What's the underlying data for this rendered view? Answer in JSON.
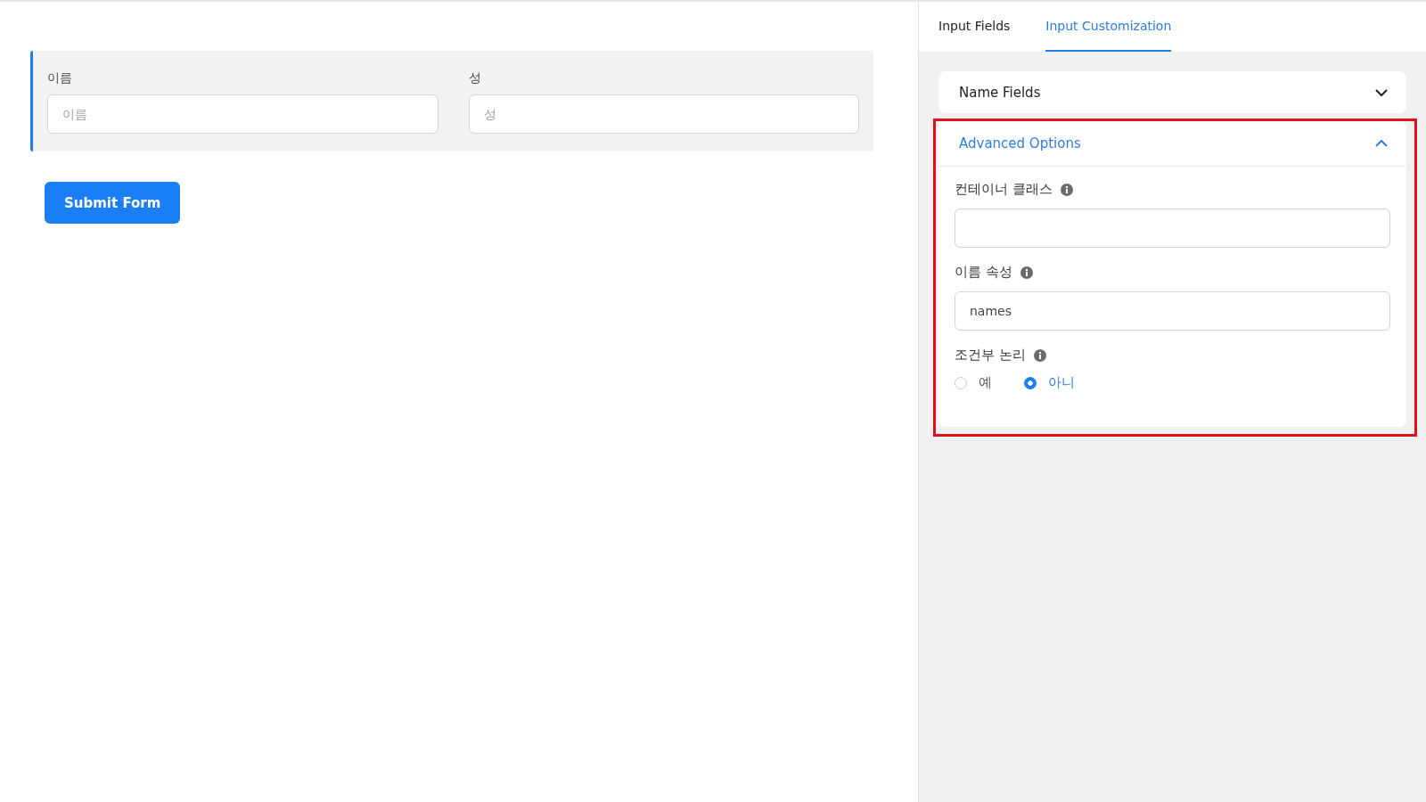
{
  "form": {
    "fields": [
      {
        "label": "이름",
        "placeholder": "이름"
      },
      {
        "label": "성",
        "placeholder": "성"
      }
    ],
    "submit": "Submit Form"
  },
  "panel": {
    "tabs": [
      {
        "label": "Input Fields",
        "selected": false
      },
      {
        "label": "Input Customization",
        "selected": true
      }
    ],
    "sections": [
      {
        "title": "Name Fields",
        "expanded": false,
        "highlighted": false
      },
      {
        "title": "Advanced Options",
        "expanded": true,
        "highlighted": true,
        "settings": [
          {
            "kind": "text",
            "label": "컨테이너 클래스"
          },
          {
            "kind": "text",
            "label": "이름 속성",
            "value": "names"
          },
          {
            "kind": "radio",
            "label": "조건부 논리",
            "options": [
              {
                "label": "예",
                "selected": false
              },
              {
                "label": "아니",
                "selected": true
              }
            ]
          }
        ]
      }
    ]
  }
}
